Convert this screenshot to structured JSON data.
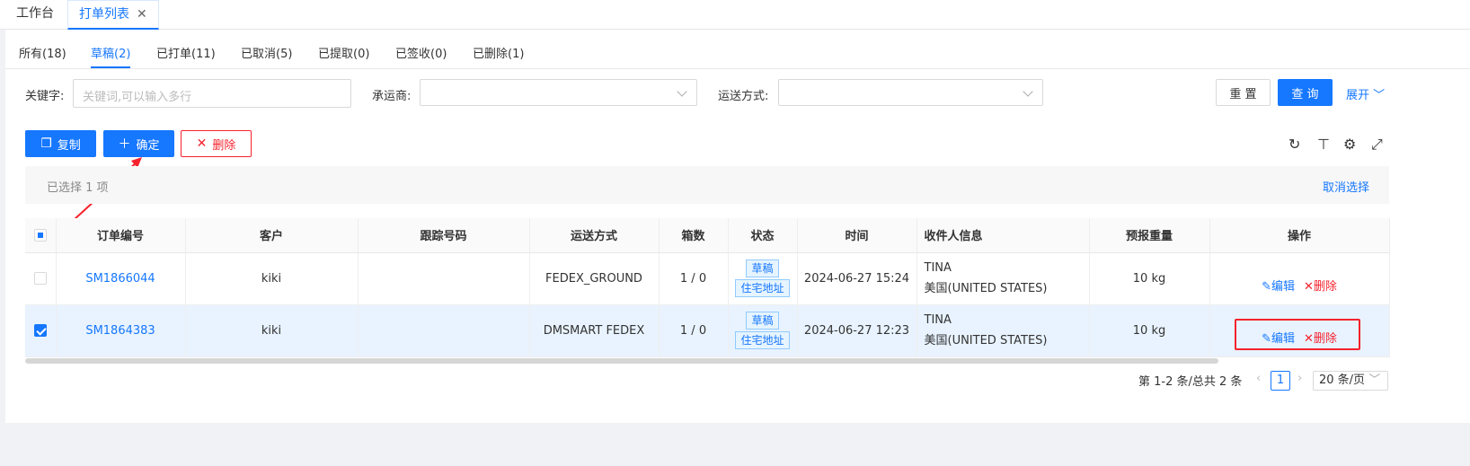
{
  "top_tabs": [
    {
      "label": "工作台"
    },
    {
      "label": "打单列表",
      "close": "✕"
    }
  ],
  "status_tabs": [
    "所有(18)",
    "草稿(2)",
    "已打单(11)",
    "已取消(5)",
    "已提取(0)",
    "已签收(0)",
    "已删除(1)"
  ],
  "filters": {
    "keyword_label": "关键字:",
    "keyword_placeholder": "关键词,可以输入多行",
    "carrier_label": "承运商:",
    "shipping_label": "运送方式:",
    "reset": "重 置",
    "query": "查 询",
    "expand": "展开"
  },
  "actions": {
    "copy": "复制",
    "confirm": "确定",
    "delete": "删除"
  },
  "selection": {
    "text": "已选择  1  项",
    "clear": "取消选择"
  },
  "table": {
    "headers": [
      "订单编号",
      "客户",
      "跟踪号码",
      "运送方式",
      "箱数",
      "状态",
      "时间",
      "收件人信息",
      "预报重量",
      "操作"
    ],
    "rows": [
      {
        "order": "SM1866044",
        "customer": "kiki",
        "tracking": "",
        "method": "FEDEX_GROUND",
        "boxes": "1 / 0",
        "status1": "草稿",
        "status2": "住宅地址",
        "time": "2024-06-27 15:24",
        "name": "TINA",
        "country": "美国(UNITED STATES)",
        "weight": "10 kg",
        "edit": "编辑",
        "del": "删除",
        "checked": false
      },
      {
        "order": "SM1864383",
        "customer": "kiki",
        "tracking": "",
        "method": "DMSMART FEDEX",
        "boxes": "1 / 0",
        "status1": "草稿",
        "status2": "住宅地址",
        "time": "2024-06-27 12:23",
        "name": "TINA",
        "country": "美国(UNITED STATES)",
        "weight": "10 kg",
        "edit": "编辑",
        "del": "删除",
        "checked": true
      }
    ]
  },
  "pagination": {
    "summary": "第 1-2 条/总共 2 条",
    "current": "1",
    "size": "20 条/页"
  },
  "colors": {
    "primary": "#1677ff",
    "danger": "#f5222d",
    "highlight": "#f5222d"
  }
}
